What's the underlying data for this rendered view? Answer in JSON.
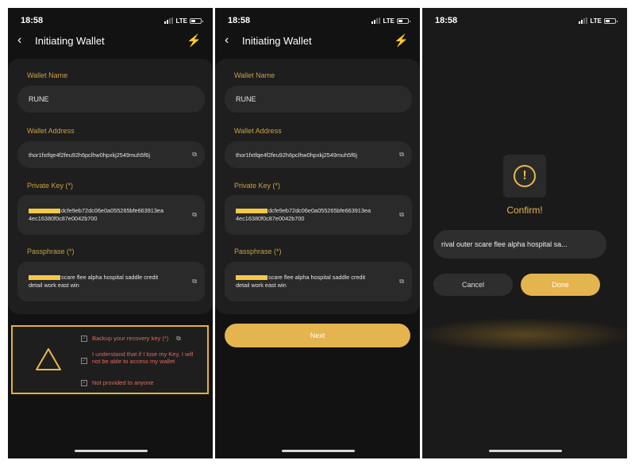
{
  "status": {
    "time": "18:58",
    "network": "LTE"
  },
  "header": {
    "title": "Initiating Wallet"
  },
  "form": {
    "wallet_name_label": "Wallet Name",
    "wallet_name_value": "RUNE",
    "wallet_address_label": "Wallet Address",
    "wallet_address_value": "thor1fxtfqe4f2feu92h6pclhw0hpxkj2549muh5f6j",
    "private_key_label": "Private Key (*)",
    "private_key_line1": "dcfe9eb72dc06e0a055265bfe663913ea",
    "private_key_line2": "4ec16380f0c87e0042b700",
    "passphrase_label": "Passphrase (*)",
    "passphrase_line1": "scare flee alpha hospital saddle credit",
    "passphrase_line2": "detail work east win"
  },
  "warning": {
    "items": [
      "Backup your recovery key (*)",
      "I understand that if I lose my Key, I will not be able to access my wallet",
      "Not provided to anyone"
    ]
  },
  "next_label": "Next",
  "confirm": {
    "title": "Confirm!",
    "phrase_preview": "rival outer scare flee alpha hospital sa...",
    "cancel_label": "Cancel",
    "done_label": "Done"
  },
  "colors": {
    "accent": "#e4b44f",
    "warning_text": "#e06a5a",
    "label": "#c9a045",
    "background": "#121212"
  }
}
